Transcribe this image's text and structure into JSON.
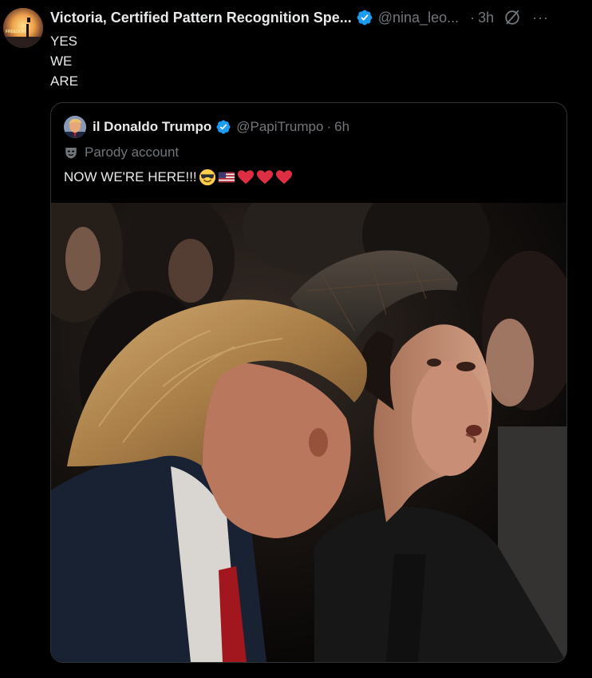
{
  "tweet": {
    "author": {
      "display_name": "Victoria, Certified Pattern Recognition Spe...",
      "handle": "@nina_leo...",
      "avatar_text": "FREEDOM",
      "verified": true
    },
    "separator": "·",
    "time": "3h",
    "more": "···",
    "lines": [
      "YES",
      "WE",
      "ARE"
    ]
  },
  "quote": {
    "author": {
      "display_name": "il Donaldo Trumpo",
      "handle": "@PapiTrumpo",
      "verified": true
    },
    "separator": "·",
    "time": "6h",
    "parody_label": "Parody account",
    "text": "NOW WE'RE HERE!!!",
    "emojis": [
      "smiling-face-with-sunglasses",
      "flag-united-states",
      "red-heart",
      "red-heart",
      "red-heart"
    ]
  },
  "colors": {
    "background": "#000000",
    "primary_text": "#e7e9ea",
    "secondary_text": "#71767b",
    "border": "#2f3336",
    "verified_blue": "#1d9bf0",
    "heart_red": "#e0245e"
  },
  "icons": {
    "verified": "verified-badge-icon",
    "grok": "grok-icon",
    "more": "more-options-icon",
    "parody": "parody-mask-icon"
  }
}
